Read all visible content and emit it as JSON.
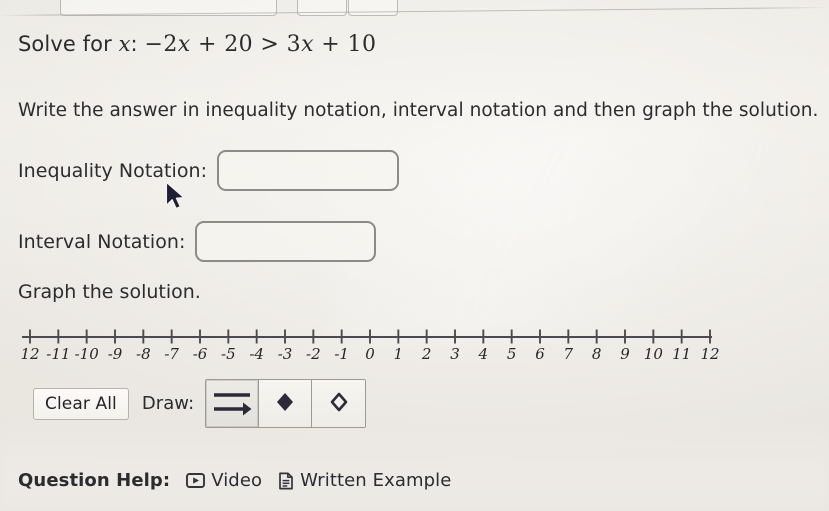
{
  "question": {
    "prompt_prefix": "Solve for",
    "prompt_variable": "x",
    "prompt_colon": ":",
    "equation": "−2x + 20 > 3x + 10",
    "equation_parts": {
      "term1_coeff": "−2",
      "term1_var": "x",
      "plus1": "+",
      "term1_const": "20",
      "relation": ">",
      "term2_coeff": "3",
      "term2_var": "x",
      "plus2": "+",
      "term2_const": "10"
    },
    "instructions": "Write the answer in inequality notation, interval notation and then graph the solution."
  },
  "fields": {
    "inequality": {
      "label": "Inequality Notation:",
      "value": "",
      "placeholder": ""
    },
    "interval": {
      "label": "Interval Notation:",
      "value": "",
      "placeholder": ""
    }
  },
  "graph": {
    "heading": "Graph the solution."
  },
  "chart_data": {
    "type": "numberline",
    "title": "Graph the solution.",
    "xlim": [
      -12,
      12
    ],
    "tick_step": 1,
    "ticks": [
      -12,
      -11,
      -10,
      -9,
      -8,
      -7,
      -6,
      -5,
      -4,
      -3,
      -2,
      -1,
      0,
      1,
      2,
      3,
      4,
      5,
      6,
      7,
      8,
      9,
      10,
      11,
      12
    ],
    "tick_labels": [
      "12",
      "-11",
      "-10",
      "-9",
      "-8",
      "-7",
      "-6",
      "-5",
      "-4",
      "-3",
      "-2",
      "-1",
      "0",
      "1",
      "2",
      "3",
      "4",
      "5",
      "6",
      "7",
      "8",
      "9",
      "10",
      "11",
      "12"
    ],
    "plotted_points": [],
    "plotted_rays": [],
    "grid": false,
    "axis_color": "#4a4a50",
    "label_color": "#26262c"
  },
  "toolbar": {
    "clear_all_label": "Clear All",
    "draw_label": "Draw:",
    "tools": [
      {
        "name": "ray-tool",
        "title": "Ray",
        "selected": true
      },
      {
        "name": "closed-dot-tool",
        "title": "Closed dot",
        "selected": false
      },
      {
        "name": "open-dot-tool",
        "title": "Open dot",
        "selected": false
      }
    ]
  },
  "help": {
    "label": "Question Help:",
    "links": [
      {
        "icon": "video-icon",
        "text": "Video"
      },
      {
        "icon": "document-icon",
        "text": "Written Example"
      }
    ]
  },
  "colors": {
    "background": "#eeeae4",
    "text": "#2b2b30",
    "field_border": "#8d8b89",
    "button_border": "#b6b3ad",
    "axis": "#4a4a50",
    "tool_ink": "#2a2a3a"
  }
}
